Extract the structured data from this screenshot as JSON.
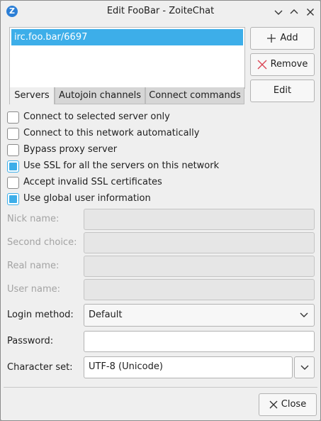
{
  "window": {
    "title": "Edit FooBar - ZoiteChat",
    "app_icon_letter": "Z",
    "controls": [
      "chevron-down-icon",
      "chevron-up-icon",
      "close-icon"
    ]
  },
  "servers": {
    "items": [
      "irc.foo.bar/6697"
    ],
    "selected": "irc.foo.bar/6697"
  },
  "tabs": [
    {
      "label": "Servers",
      "active": true
    },
    {
      "label": "Autojoin channels",
      "active": false
    },
    {
      "label": "Connect commands",
      "active": false
    }
  ],
  "buttons": {
    "add": "Add",
    "remove": "Remove",
    "edit": "Edit",
    "close": "Close"
  },
  "options": [
    {
      "label": "Connect to selected server only",
      "checked": false
    },
    {
      "label": "Connect to this network automatically",
      "checked": false
    },
    {
      "label": "Bypass proxy server",
      "checked": false
    },
    {
      "label": "Use SSL for all the servers on this network",
      "checked": true
    },
    {
      "label": "Accept invalid SSL certificates",
      "checked": false
    },
    {
      "label": "Use global user information",
      "checked": true
    }
  ],
  "fields": {
    "nick_name": {
      "label": "Nick name:",
      "value": "",
      "disabled": true
    },
    "second_choice": {
      "label": "Second choice:",
      "value": "",
      "disabled": true
    },
    "real_name": {
      "label": "Real name:",
      "value": "",
      "disabled": true
    },
    "user_name": {
      "label": "User name:",
      "value": "",
      "disabled": true
    },
    "login_method": {
      "label": "Login method:",
      "value": "Default"
    },
    "password": {
      "label": "Password:",
      "value": ""
    },
    "character_set": {
      "label": "Character set:",
      "value": "UTF-8 (Unicode)"
    }
  },
  "colors": {
    "accent": "#3daee9",
    "remove_icon": "#da4453"
  }
}
